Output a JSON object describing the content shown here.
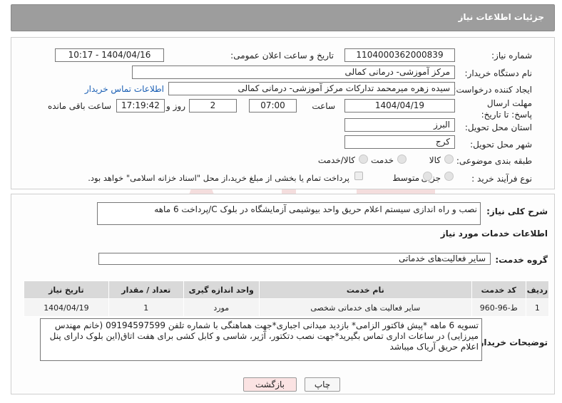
{
  "header": {
    "title": "جزئیات اطلاعات نیاز"
  },
  "fields": {
    "need_number_label": "شماره نیاز:",
    "need_number": "1104000362000839",
    "announce_label": "تاریخ و ساعت اعلان عمومی:",
    "announce_value": "1404/04/16 - 10:17",
    "buyer_org_label": "نام دستگاه خریدار:",
    "buyer_org": "مرکز آموزشی- درمانی کمالی",
    "creator_label": "ایجاد کننده درخواست:",
    "creator": "سیده زهره میرمحمد تدارکات مرکز آموزشی- درمانی کمالی",
    "contact_link": "اطلاعات تماس خریدار",
    "deadline_label": "مهلت ارسال پاسخ: تا تاریخ:",
    "deadline_date": "1404/04/19",
    "time_label": "ساعت",
    "deadline_time": "07:00",
    "days_value": "2",
    "days_label": "روز و",
    "remaining_time": "17:19:42",
    "remaining_label": "ساعت باقی مانده",
    "province_label": "استان محل تحویل:",
    "province": "البرز",
    "city_label": "شهر محل تحویل:",
    "city": "کرج",
    "category_label": "طبقه بندی موضوعی:",
    "category_options": [
      "کالا",
      "خدمت",
      "کالا/خدمت"
    ],
    "purchase_type_label": "نوع فرآیند خرید :",
    "purchase_type_options": [
      "جزیی",
      "متوسط"
    ],
    "payment_note": "پرداخت تمام یا بخشی از مبلغ خرید،از محل \"اسناد خزانه اسلامی\" خواهد بود."
  },
  "description": {
    "label": "شرح کلی نیاز:",
    "value": "نصب و راه اندازی سیستم اعلام حریق واحد بیوشیمی آزمایشگاه در بلوک C/پرداخت 6 ماهه"
  },
  "services": {
    "section_title": "اطلاعات خدمات مورد نیاز",
    "group_label": "گروه خدمت:",
    "group_value": "سایر فعالیت‌های خدماتی",
    "columns": [
      "ردیف",
      "کد خدمت",
      "نام خدمت",
      "واحد اندازه گیری",
      "تعداد / مقدار",
      "تاریخ نیاز"
    ],
    "rows": [
      [
        "1",
        "ط-96-960",
        "سایر فعالیت های خدماتی شخصی",
        "مورد",
        "1",
        "1404/04/19"
      ]
    ]
  },
  "buyer_notes": {
    "label": "توضیحات خریدار:",
    "value": "تسویه 6 ماهه *پیش فاکتور الزامی* بازدید میدانی اجباری*جهت هماهنگی با شماره تلفن 09194597599 (خانم مهندس میرزایی) در ساعات اداری تماس بگیرید*جهت نصب دتکتور، آژیر، شاسی و کابل کشی برای هفت اتاق(این بلوک دارای پنل اعلام حریق آریاک میباشد"
  },
  "buttons": {
    "print": "چاپ",
    "back": "بازگشت"
  },
  "colors": {
    "header_bg": "#9d9d9d",
    "link": "#1a5fb4",
    "back_button_bg": "#fbe3e3"
  }
}
